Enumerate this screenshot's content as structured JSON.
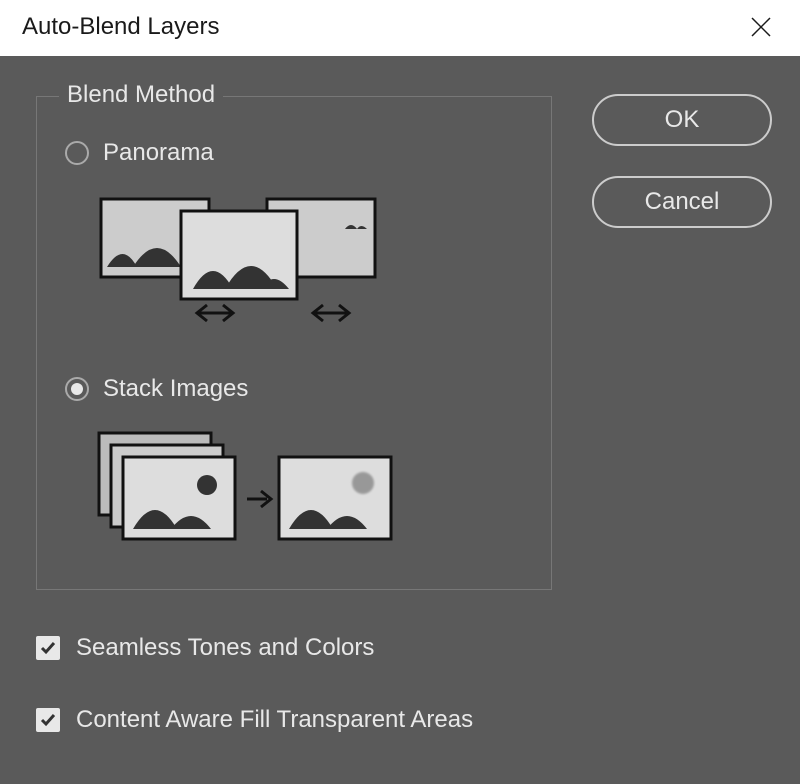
{
  "titlebar": {
    "title": "Auto-Blend Layers"
  },
  "fieldset": {
    "legend": "Blend Method",
    "options": {
      "panorama": {
        "label": "Panorama",
        "selected": false
      },
      "stack": {
        "label": "Stack Images",
        "selected": true
      }
    }
  },
  "checkboxes": {
    "seamless": {
      "label": "Seamless Tones and Colors",
      "checked": true
    },
    "contentAware": {
      "label": "Content Aware Fill Transparent Areas",
      "checked": true
    }
  },
  "buttons": {
    "ok": "OK",
    "cancel": "Cancel"
  }
}
